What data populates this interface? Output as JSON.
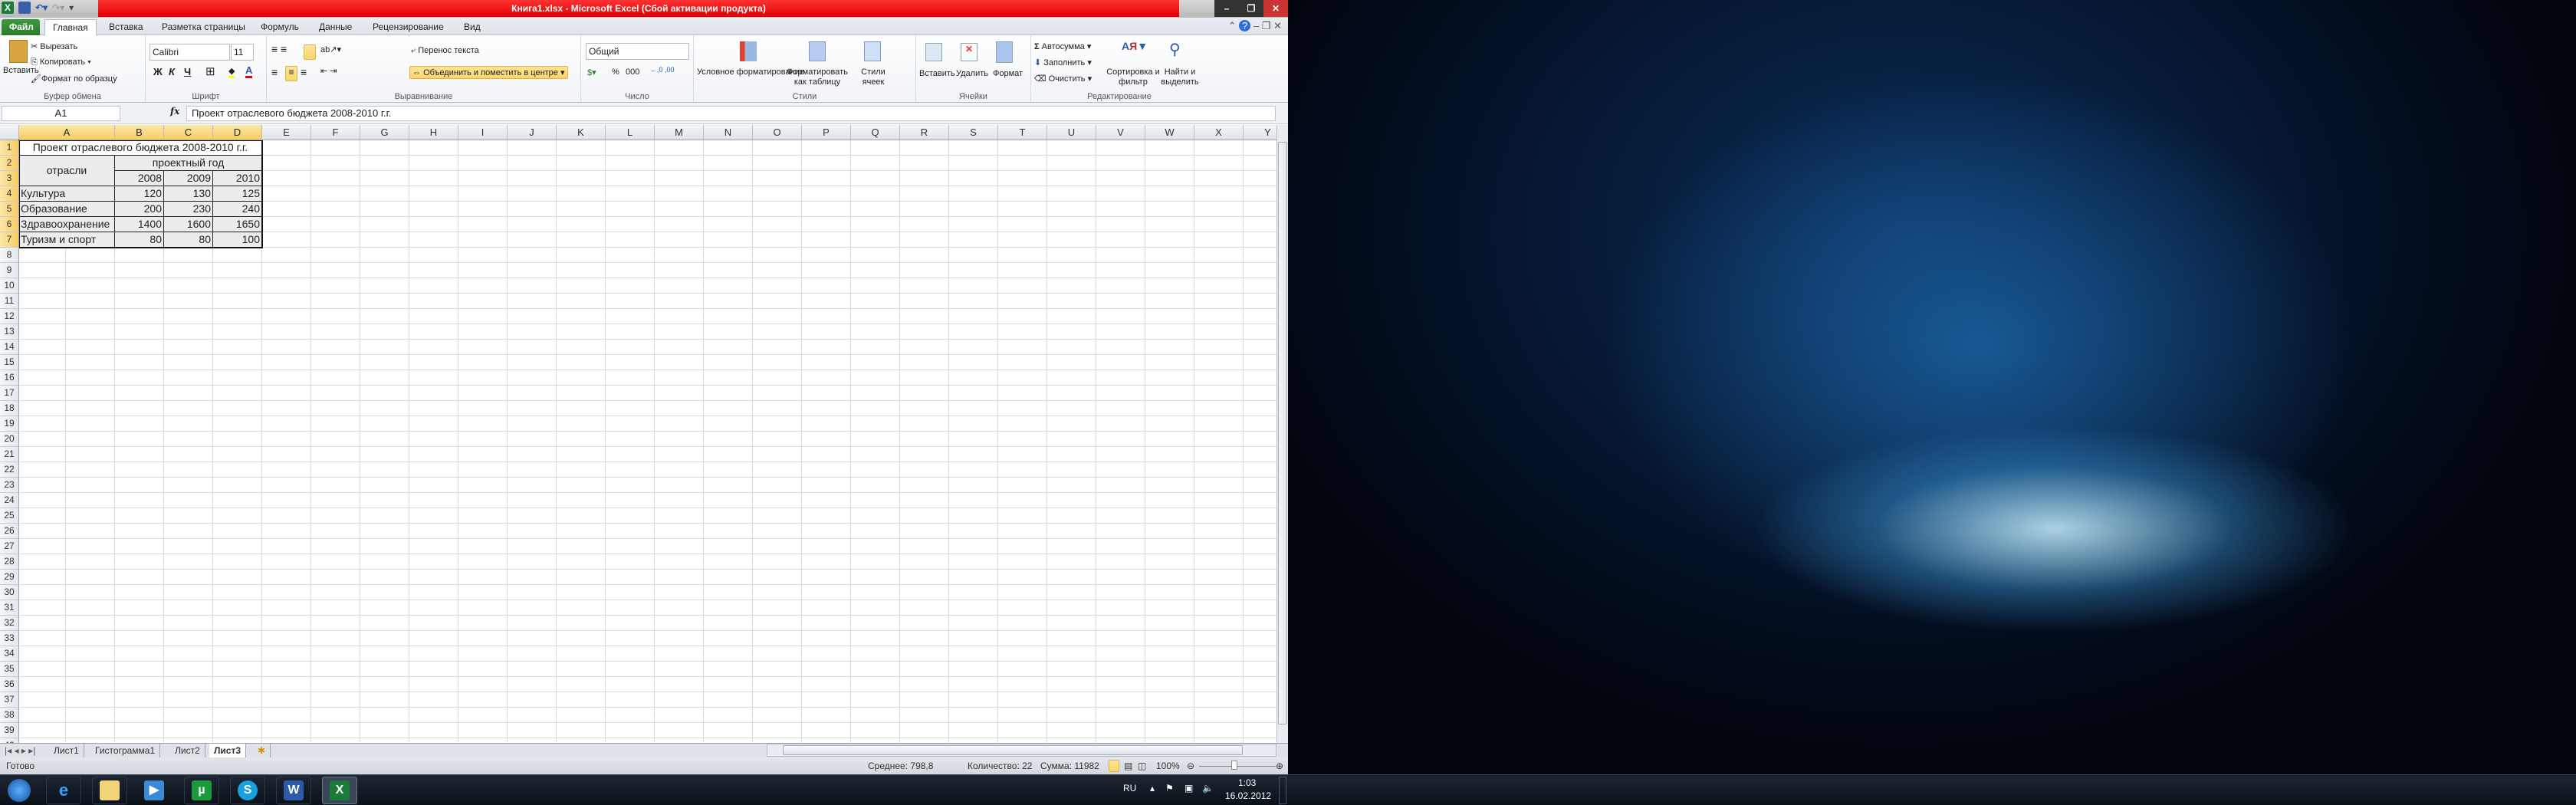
{
  "title": "Книга1.xlsx - Microsoft Excel (Сбой активации продукта)",
  "tabs": [
    "Файл",
    "Главная",
    "Вставка",
    "Разметка страницы",
    "Формуль",
    "Данные",
    "Рецензирование",
    "Вид"
  ],
  "ribbon": {
    "clipboard": {
      "paste": "Вставить",
      "cut": "Вырезать",
      "copy": "Копировать",
      "format_painter": "Формат по образцу",
      "label": "Буфер обмена"
    },
    "font": {
      "name": "Calibri",
      "size": "11",
      "bold": "Ж",
      "italic": "К",
      "underline": "Ч",
      "label": "Шрифт"
    },
    "alignment": {
      "wrap": "Перенос текста",
      "merge": "Объединить и поместить в центре",
      "label": "Выравнивание"
    },
    "number": {
      "format": "Общий",
      "percent": "%",
      "thousands": "000",
      "label": "Число"
    },
    "styles": {
      "conditional": "Условное форматирование",
      "as_table": "Форматировать как таблицу",
      "cell_styles": "Стили ячеек",
      "label": "Стили"
    },
    "cells": {
      "insert": "Вставить",
      "delete": "Удалить",
      "format": "Формат",
      "label": "Ячейки"
    },
    "editing": {
      "autosum": "Автосумма",
      "fill": "Заполнить",
      "clear": "Очистить",
      "sort": "Сортировка и фильтр",
      "find": "Найти и выделить",
      "label": "Редактирование"
    }
  },
  "formula_bar": {
    "name_box": "A1",
    "fx": "fx",
    "value": "Проект отраслевого бюджета 2008-2010 г.г."
  },
  "columns": [
    "A",
    "B",
    "C",
    "D",
    "E",
    "F",
    "G",
    "H",
    "I",
    "J",
    "K",
    "L",
    "M",
    "N",
    "O",
    "P",
    "Q",
    "R",
    "S",
    "T",
    "U",
    "V",
    "W",
    "X",
    "Y"
  ],
  "row_count": 40,
  "table": {
    "title": "Проект отраслевого бюджета 2008-2010 г.г.",
    "header_branch": "отрасли",
    "header_year": "проектный год",
    "years": [
      "2008",
      "2009",
      "2010"
    ],
    "rows": [
      {
        "name": "Культура",
        "values": [
          "120",
          "130",
          "125"
        ]
      },
      {
        "name": "Образование",
        "values": [
          "200",
          "230",
          "240"
        ]
      },
      {
        "name": "Здравоохранение",
        "values": [
          "1400",
          "1600",
          "1650"
        ]
      },
      {
        "name": "Туризм и спорт",
        "values": [
          "80",
          "80",
          "100"
        ]
      }
    ]
  },
  "sheets": [
    "Лист1",
    "Гистограмма1",
    "Лист2",
    "Лист3"
  ],
  "active_sheet": "Лист3",
  "status": {
    "ready": "Готово",
    "average": "Среднее: 798,8",
    "count": "Количество: 22",
    "sum": "Сумма: 11982",
    "zoom": "100%"
  },
  "tray": {
    "lang": "RU",
    "time": "1:03",
    "date": "16.02.2012"
  }
}
